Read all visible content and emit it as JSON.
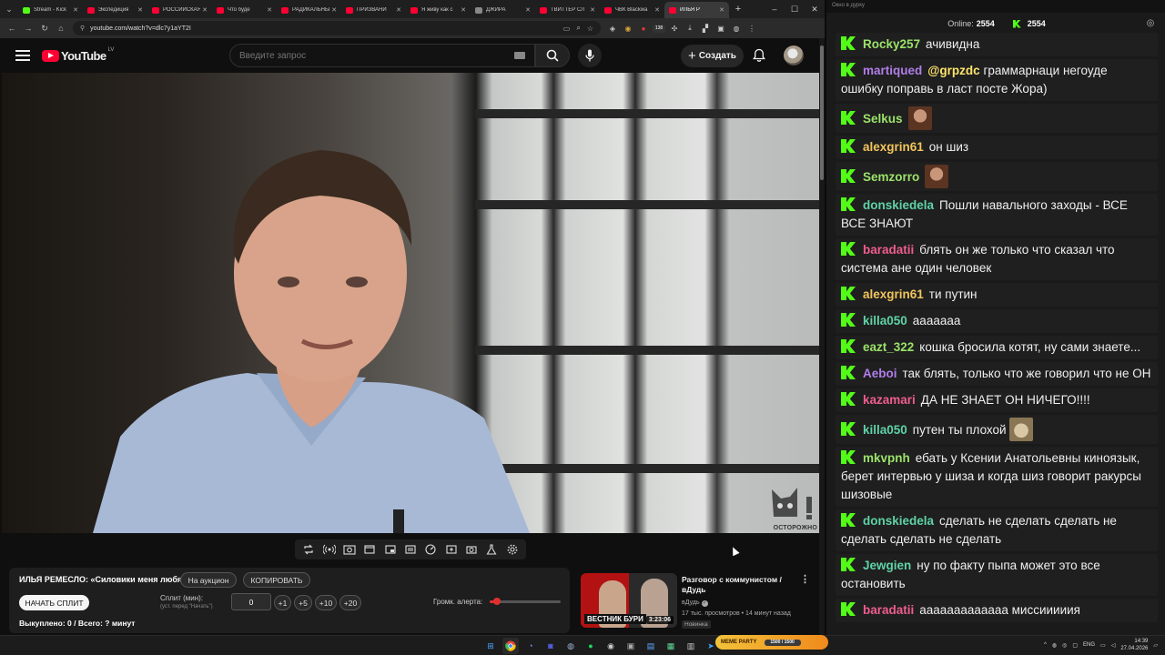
{
  "browser": {
    "tabs": [
      {
        "label": "Stream - Kick",
        "icon": "kick",
        "active": false
      },
      {
        "label": "Экспедиция",
        "icon": "yt",
        "active": false
      },
      {
        "label": "РОССИЙСКАЯ",
        "icon": "yt",
        "active": false
      },
      {
        "label": "Что буде",
        "icon": "yt",
        "active": false
      },
      {
        "label": "РАДИКАЛЬНЫ",
        "icon": "yt",
        "active": false
      },
      {
        "label": "ПРИЗВАНИ",
        "icon": "yt",
        "active": false
      },
      {
        "label": "Я живу как с",
        "icon": "yt",
        "active": false
      },
      {
        "label": "ДЖИРА",
        "icon": "ext",
        "active": false
      },
      {
        "label": "ТВИТТЕР СЛ",
        "icon": "yt",
        "active": false
      },
      {
        "label": "ЧВК Blackwa",
        "icon": "yt",
        "active": false
      },
      {
        "label": "ИЛЬЯ Р",
        "icon": "yt",
        "active": true
      }
    ],
    "url": "youtube.com/watch?v=dlc7y1aYT2I",
    "ext_badge": "138"
  },
  "youtube": {
    "logo_text": "YouTube",
    "logo_country": "LV",
    "search_placeholder": "Введите запрос",
    "create_label": "Создать",
    "watermark_text": "ОСТОРОЖНО"
  },
  "split_panel": {
    "title": "ИЛЬЯ РЕМЕСЛО: «Силовики меня любят»",
    "auction_label": "На аукцион",
    "copy_label": "КОПИРОВАТЬ",
    "start_label": "НАЧАТЬ СПЛИТ",
    "split_label": "Сплит (мин):",
    "split_hint": "(уст. перед \"Начать\")",
    "split_value": "0",
    "inc_buttons": [
      "+1",
      "+5",
      "+10",
      "+20"
    ],
    "volume_label": "Громк. алерта:",
    "volume_level": 0.1,
    "stats": "Выкуплено: 0 / Всего: ? минут"
  },
  "recommendation": {
    "title": "Разговор с коммунистом / вДудь",
    "channel": "вДудь",
    "views": "17 тыс. просмотров",
    "age": "14 минут назад",
    "badge": "Новинка",
    "duration": "3:23:06",
    "thumb_label": "ВЕСТНИК БУРИ"
  },
  "chat": {
    "window_title": "Окно в дурку",
    "online_label": "Online:",
    "online_count": "2554",
    "kick_count": "2554",
    "messages": [
      {
        "user": "Rocky257",
        "color": "#9be36a",
        "text": "ачивидна"
      },
      {
        "user": "martiqued",
        "color": "#b07ee8",
        "mention": "@grpzdc",
        "text": " граммарнаци негоуде ошибку поправь в ласт посте Жора)"
      },
      {
        "user": "Selkus",
        "color": "#9be36a",
        "text": "",
        "emote": "face"
      },
      {
        "user": "alexgrin61",
        "color": "#f2c55c",
        "text": "он шиз"
      },
      {
        "user": "Semzorro",
        "color": "#9be36a",
        "text": "",
        "emote": "face"
      },
      {
        "user": "donskiedela",
        "color": "#5fd3a7",
        "text": "Пошли навального заходы - ВСЕ ВСЕ ЗНАЮТ"
      },
      {
        "user": "baradatii",
        "color": "#ef5d8f",
        "text": "блять он же только что сказал что система ане один человек"
      },
      {
        "user": "alexgrin61",
        "color": "#f2c55c",
        "text": "ти путин"
      },
      {
        "user": "killa050",
        "color": "#5fd3a7",
        "text": "ааааааа"
      },
      {
        "user": "eazt_322",
        "color": "#9be36a",
        "text": "кошка бросила котят, ну сами знаете..."
      },
      {
        "user": "Aeboi",
        "color": "#b07ee8",
        "text": "так блять, только что же говорил что не ОН"
      },
      {
        "user": "kazamari",
        "color": "#ef5d8f",
        "text": "ДА НЕ ЗНАЕТ ОН НИЧЕГО!!!!"
      },
      {
        "user": "killa050",
        "color": "#5fd3a7",
        "text": "путен ты плохой",
        "emote": "cat"
      },
      {
        "user": "mkvpnh",
        "color": "#9be36a",
        "text": "ебать у Ксении Анатольевны киноязык, берет интервью у шиза и когда шиз говорит ракурсы шизовые"
      },
      {
        "user": "donskiedela",
        "color": "#5fd3a7",
        "text": "сделать не сделать сделать не сделать сделать не сделать"
      },
      {
        "user": "Jewgien",
        "color": "#5fd3a7",
        "text": "ну по факту пыпа может это все остановить"
      },
      {
        "user": "baradatii",
        "color": "#ef5d8f",
        "text": "ааааааааааааа миссииииия"
      }
    ]
  },
  "taskbar": {
    "meme_party": "MEME PARTY",
    "meme_progress": "1500 / 1500",
    "lang": "ENG",
    "time": "14:39",
    "date": "27.04.2026"
  }
}
